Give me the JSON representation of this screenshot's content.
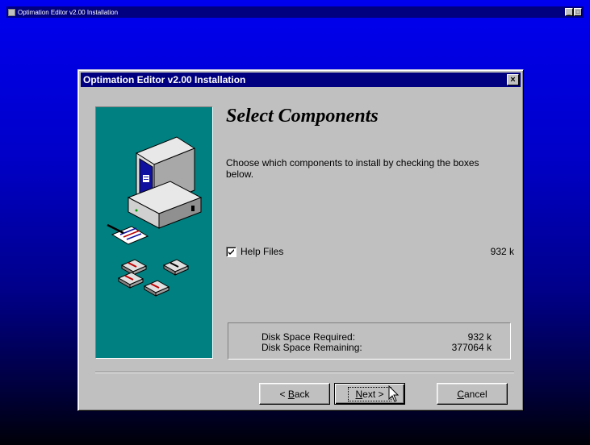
{
  "screen": {
    "title": "Optimation Editor v2.00 Installation",
    "controls": {
      "minimize": "_",
      "maximize": "□"
    }
  },
  "dialog": {
    "title": "Optimation Editor v2.00 Installation",
    "close_glyph": "×",
    "heading": "Select Components",
    "description": "Choose which components to install by checking the boxes below.",
    "components": [
      {
        "label": "Help Files",
        "size": "932 k",
        "checked": true
      }
    ],
    "disk_space": {
      "required_label": "Disk Space Required:",
      "required_value": "932 k",
      "remaining_label": "Disk Space Remaining:",
      "remaining_value": "377064 k"
    },
    "buttons": {
      "back": {
        "before": "< ",
        "mnemonic": "B",
        "after": "ack"
      },
      "next": {
        "mnemonic": "N",
        "after": "ext >"
      },
      "cancel": {
        "mnemonic": "C",
        "after": "ancel"
      }
    }
  },
  "colors": {
    "desktop_top": "#0000f0",
    "titlebar": "#000080",
    "face": "#c0c0c0",
    "art_background": "#008080"
  },
  "icons": [
    "setup-icon",
    "computer-icon",
    "disk-icon",
    "arrow-cursor-icon",
    "checkmark-icon",
    "close-icon"
  ]
}
